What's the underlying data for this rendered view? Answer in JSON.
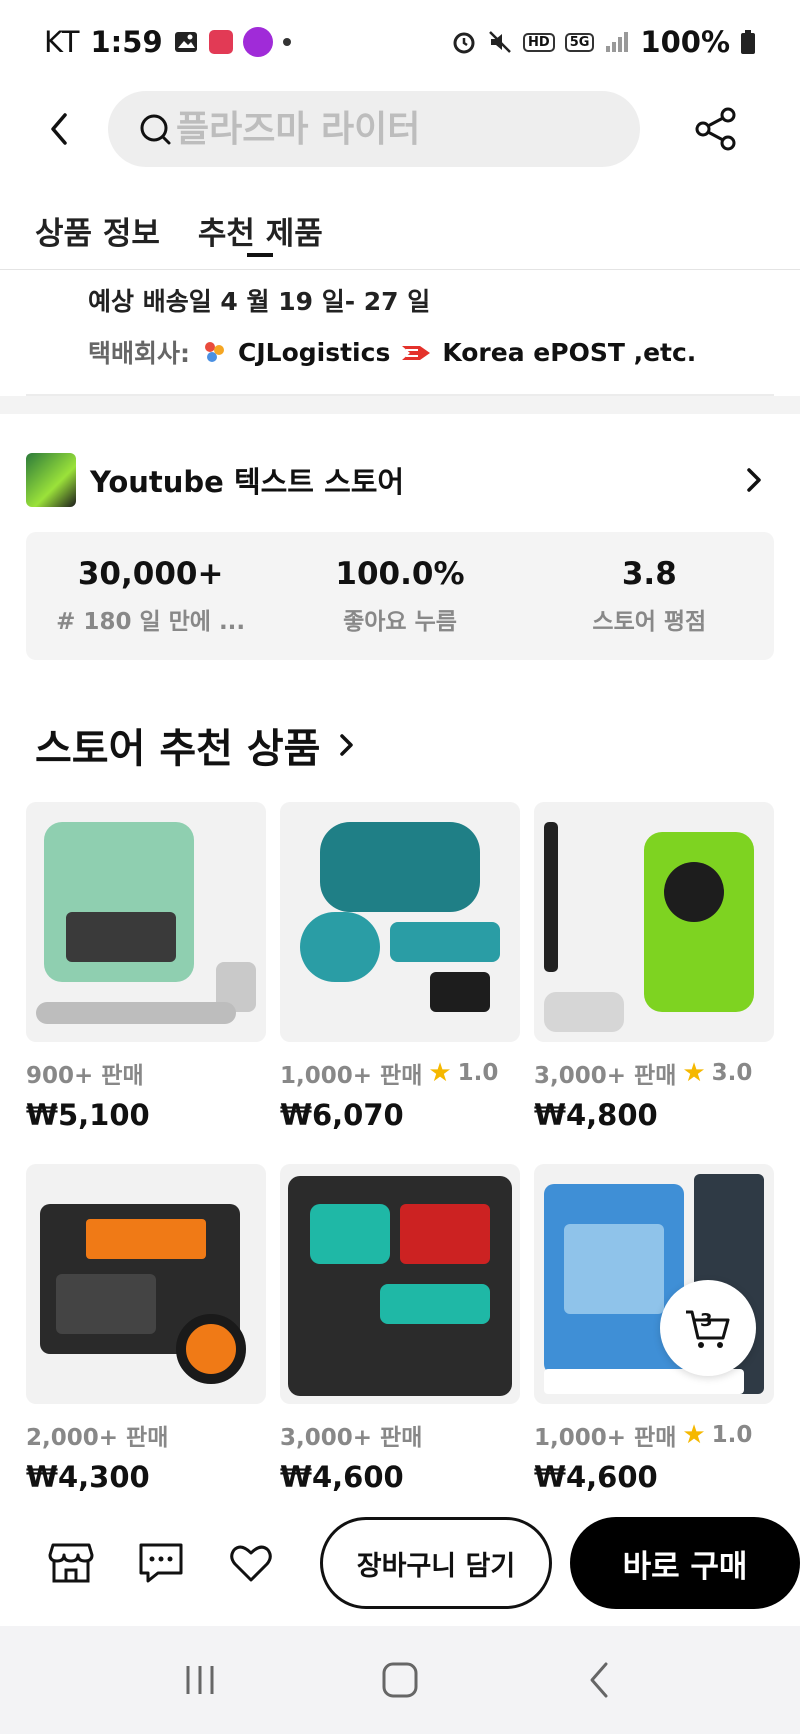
{
  "status_bar": {
    "carrier": "KT",
    "time": "1:59",
    "battery": "100%",
    "chip_hd": "HD",
    "chip_5g": "5G"
  },
  "header": {
    "search_placeholder": "플라즈마 라이터"
  },
  "tabs": [
    {
      "label": "상품 정보"
    },
    {
      "label": "추천 제품"
    }
  ],
  "shipping": {
    "estimated": "예상 배송일 4 월 19 일- 27 일",
    "company_label": "택배회사:",
    "company_cj": "CJLogistics",
    "company_post": "Korea ePOST ,etc."
  },
  "store": {
    "name": "Youtube 텍스트 스토어",
    "stats": [
      {
        "value": "30,000+",
        "label": "#  180 일 만에 ..."
      },
      {
        "value": "100.0%",
        "label": "좋아요 누름"
      },
      {
        "value": "3.8",
        "label": "스토어 평점"
      }
    ]
  },
  "recommend": {
    "title": "스토어 추천 상품",
    "products": [
      {
        "sold": "900+ 판매",
        "rating": "",
        "price": "₩5,100"
      },
      {
        "sold": "1,000+ 판매",
        "rating": "1.0",
        "price": "₩6,070"
      },
      {
        "sold": "3,000+ 판매",
        "rating": "3.0",
        "price": "₩4,800"
      },
      {
        "sold": "2,000+ 판매",
        "rating": "",
        "price": "₩4,300"
      },
      {
        "sold": "3,000+ 판매",
        "rating": "",
        "price": "₩4,600"
      },
      {
        "sold": "1,000+ 판매",
        "rating": "1.0",
        "price": "₩4,600"
      }
    ],
    "cart_count": "3"
  },
  "actions": {
    "add_to_cart": "장바구니 담기",
    "buy_now": "바로 구매"
  },
  "colors": {
    "star": "#f5b800",
    "primary": "#000000"
  }
}
